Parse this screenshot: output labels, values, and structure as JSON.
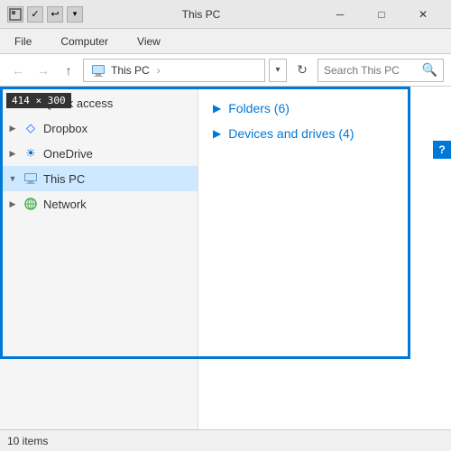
{
  "window": {
    "title": "This PC",
    "size_label": "414 × 300"
  },
  "ribbon": {
    "tabs": [
      "File",
      "Computer",
      "View"
    ]
  },
  "address_bar": {
    "path": "This PC",
    "breadcrumb": [
      "This PC"
    ],
    "search_placeholder": "Search This PC",
    "separator": "›"
  },
  "sidebar": {
    "items": [
      {
        "id": "quick-access",
        "label": "Quick access",
        "icon": "star",
        "expanded": false
      },
      {
        "id": "dropbox",
        "label": "Dropbox",
        "icon": "dropbox",
        "expanded": false
      },
      {
        "id": "onedrive",
        "label": "OneDrive",
        "icon": "onedrive",
        "expanded": false
      },
      {
        "id": "this-pc",
        "label": "This PC",
        "icon": "thispc",
        "expanded": true,
        "selected": true
      },
      {
        "id": "network",
        "label": "Network",
        "icon": "network",
        "expanded": false
      }
    ]
  },
  "main_pane": {
    "sections": [
      {
        "label": "Folders (6)",
        "id": "folders"
      },
      {
        "label": "Devices and drives (4)",
        "id": "drives"
      }
    ]
  },
  "status_bar": {
    "text": "10 items"
  },
  "scrollbar": {
    "color": "#0078d7"
  }
}
